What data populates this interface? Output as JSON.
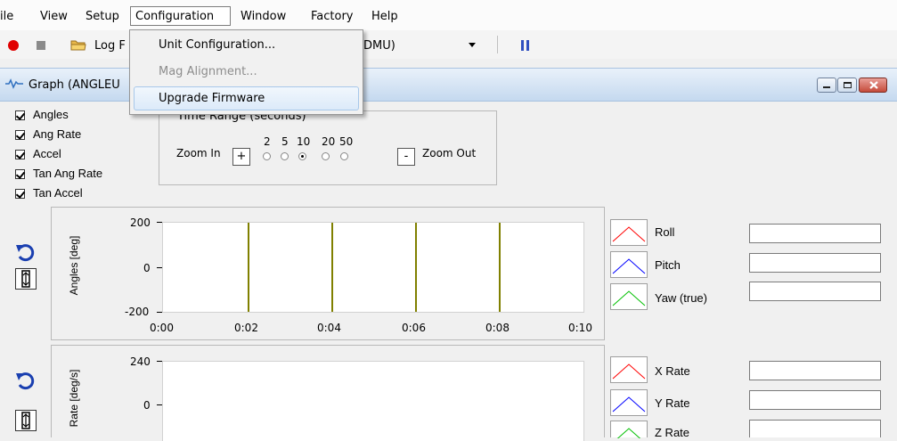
{
  "menubar": {
    "items": [
      "ile",
      "View",
      "Setup",
      "Configuration",
      "Window",
      "Factory",
      "Help"
    ]
  },
  "toolbar": {
    "log_label": "Log F",
    "device_text": "DMU)"
  },
  "config_menu": {
    "items": [
      {
        "label": "Unit Configuration...",
        "enabled": true
      },
      {
        "label": "Mag Alignment...",
        "enabled": false
      },
      {
        "label": "Upgrade Firmware",
        "enabled": true,
        "highlighted": true
      }
    ]
  },
  "graph_window": {
    "title": "Graph (ANGLEU"
  },
  "checkboxes": [
    {
      "label": "Angles",
      "checked": true
    },
    {
      "label": "Ang Rate",
      "checked": true
    },
    {
      "label": "Accel",
      "checked": true
    },
    {
      "label": "Tan Ang Rate",
      "checked": true
    },
    {
      "label": "Tan Accel",
      "checked": true
    }
  ],
  "time_range": {
    "title": "Time Range (seconds)",
    "zoom_in": "Zoom In",
    "zoom_out": "Zoom Out",
    "plus": "+",
    "minus": "-",
    "options": [
      "2",
      "5",
      "10",
      "20",
      "50"
    ],
    "selected": "10"
  },
  "chart_data": [
    {
      "type": "line",
      "ylabel": "Angles [deg]",
      "ylim": [
        -200,
        200
      ],
      "y_ticks": [
        "200",
        "0",
        "-200"
      ],
      "x_ticks": [
        "0:00",
        "0:02",
        "0:04",
        "0:06",
        "0:08",
        "0:10"
      ],
      "series": [
        {
          "name": "Roll",
          "color": "#ff0000"
        },
        {
          "name": "Pitch",
          "color": "#0000ff"
        },
        {
          "name": "Yaw (true)",
          "color": "#00c000"
        }
      ]
    },
    {
      "type": "line",
      "ylabel": "Rate [deg/s]",
      "y_ticks": [
        "240",
        "0"
      ],
      "series": [
        {
          "name": "X Rate",
          "color": "#ff0000"
        },
        {
          "name": "Y Rate",
          "color": "#0000ff"
        },
        {
          "name": "Z Rate",
          "color": "#00c000"
        }
      ]
    }
  ],
  "colors": {
    "grid_line": "#808000",
    "record": "#e00000",
    "pause": "#3050c0"
  }
}
